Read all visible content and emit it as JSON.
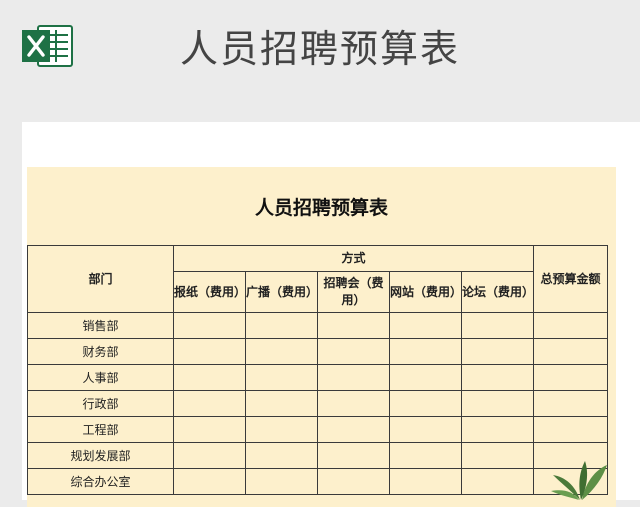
{
  "header": {
    "app_icon": "excel-icon",
    "title": "人员招聘预算表"
  },
  "sheet": {
    "title": "人员招聘预算表",
    "table": {
      "dept_header": "部门",
      "method_header": "方式",
      "total_header": "总预算金额",
      "methods": [
        "报纸（费用）",
        "广播（费用）",
        "招聘会（费用）",
        "网站（费用）",
        "论坛（费用）"
      ],
      "departments": [
        "销售部",
        "财务部",
        "人事部",
        "行政部",
        "工程部",
        "规划发展部",
        "综合办公室"
      ]
    }
  },
  "colors": {
    "background": "#ebebeb",
    "sheet": "#fdf0cc",
    "excel_green": "#1e7145"
  }
}
